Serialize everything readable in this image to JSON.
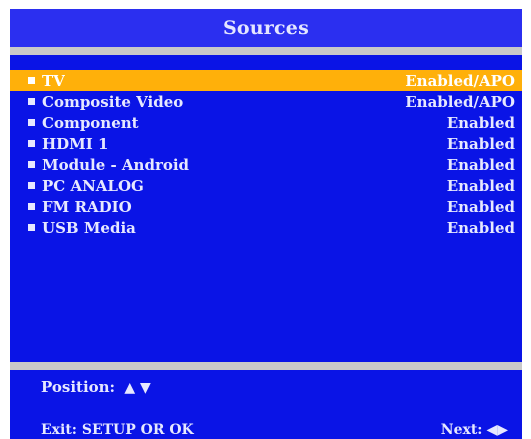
{
  "header": {
    "title": "Sources"
  },
  "sources": [
    {
      "label": "TV",
      "status": "Enabled/APO",
      "selected": true
    },
    {
      "label": "Composite Video",
      "status": "Enabled/APO",
      "selected": false
    },
    {
      "label": "Component",
      "status": "Enabled",
      "selected": false
    },
    {
      "label": "HDMI 1",
      "status": "Enabled",
      "selected": false
    },
    {
      "label": "Module - Android",
      "status": "Enabled",
      "selected": false
    },
    {
      "label": "PC ANALOG",
      "status": "Enabled",
      "selected": false
    },
    {
      "label": "FM RADIO",
      "status": "Enabled",
      "selected": false
    },
    {
      "label": "USB Media",
      "status": "Enabled",
      "selected": false
    }
  ],
  "footer": {
    "position_label": "Position:",
    "position_arrows": "▲ ▼",
    "exit_label": "Exit:  SETUP OR OK",
    "next_label": "Next:",
    "next_arrows": "◀▶"
  },
  "colors": {
    "panel": "#0a14e6",
    "title_bar": "#2b2ff0",
    "highlight": "#ffb00a",
    "separator": "#c9c9c9",
    "text": "#e6e8ff"
  }
}
